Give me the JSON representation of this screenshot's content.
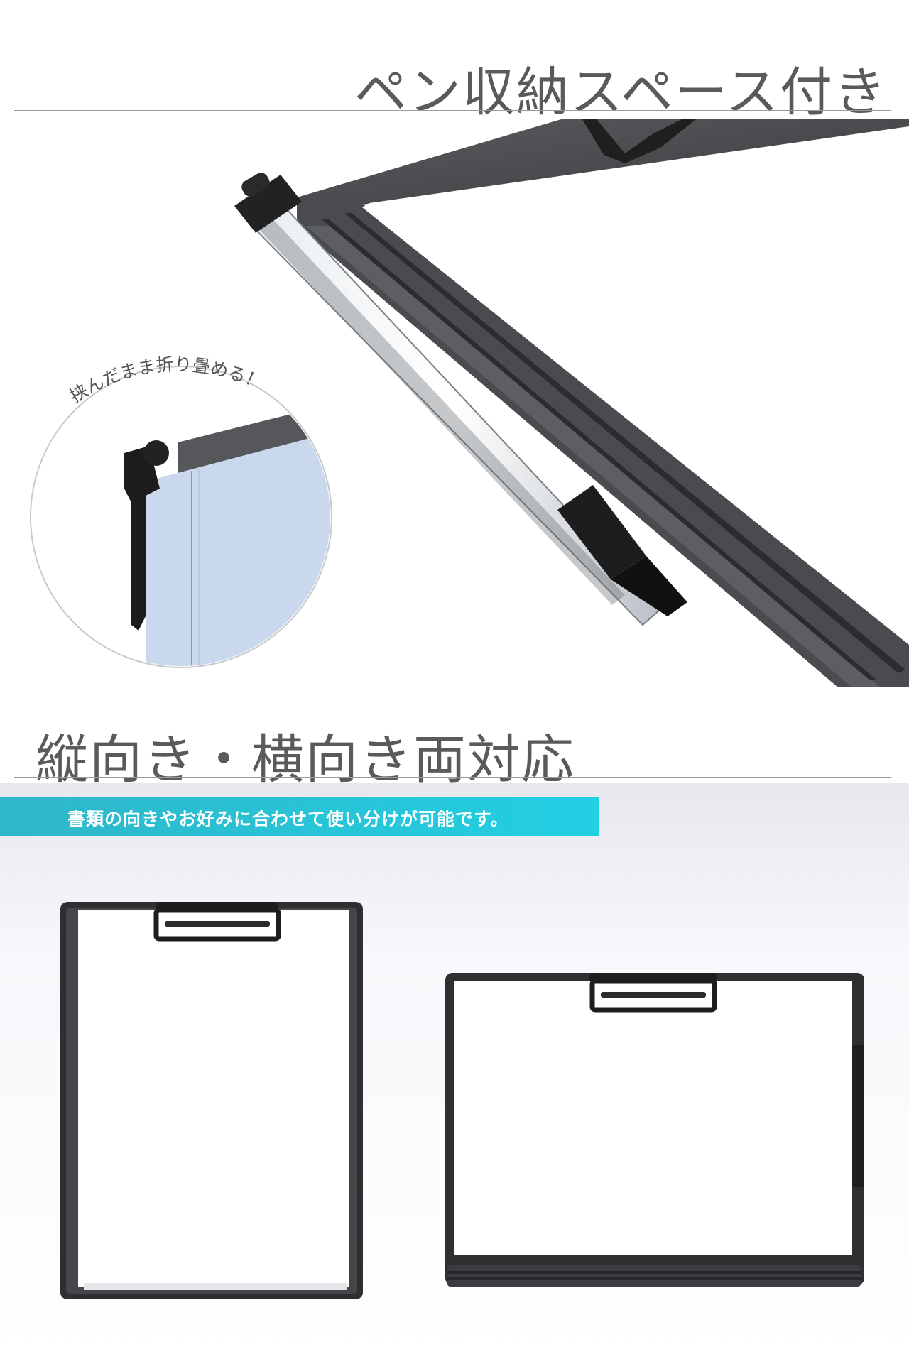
{
  "section1": {
    "title": "ペン収納スペース付き",
    "callout_caption": "挟んだまま折り畳める！"
  },
  "section2": {
    "title": "縦向き・横向き両対応",
    "banner_text": "書類の向きやお好みに合わせて使い分けが可能です。",
    "banner_color": "#22cfe3"
  },
  "colors": {
    "heading_text": "#5a5a5a",
    "board_frame": "#3c3c3e",
    "paper": "#ffffff",
    "folder_blue": "#c9d8ec"
  }
}
